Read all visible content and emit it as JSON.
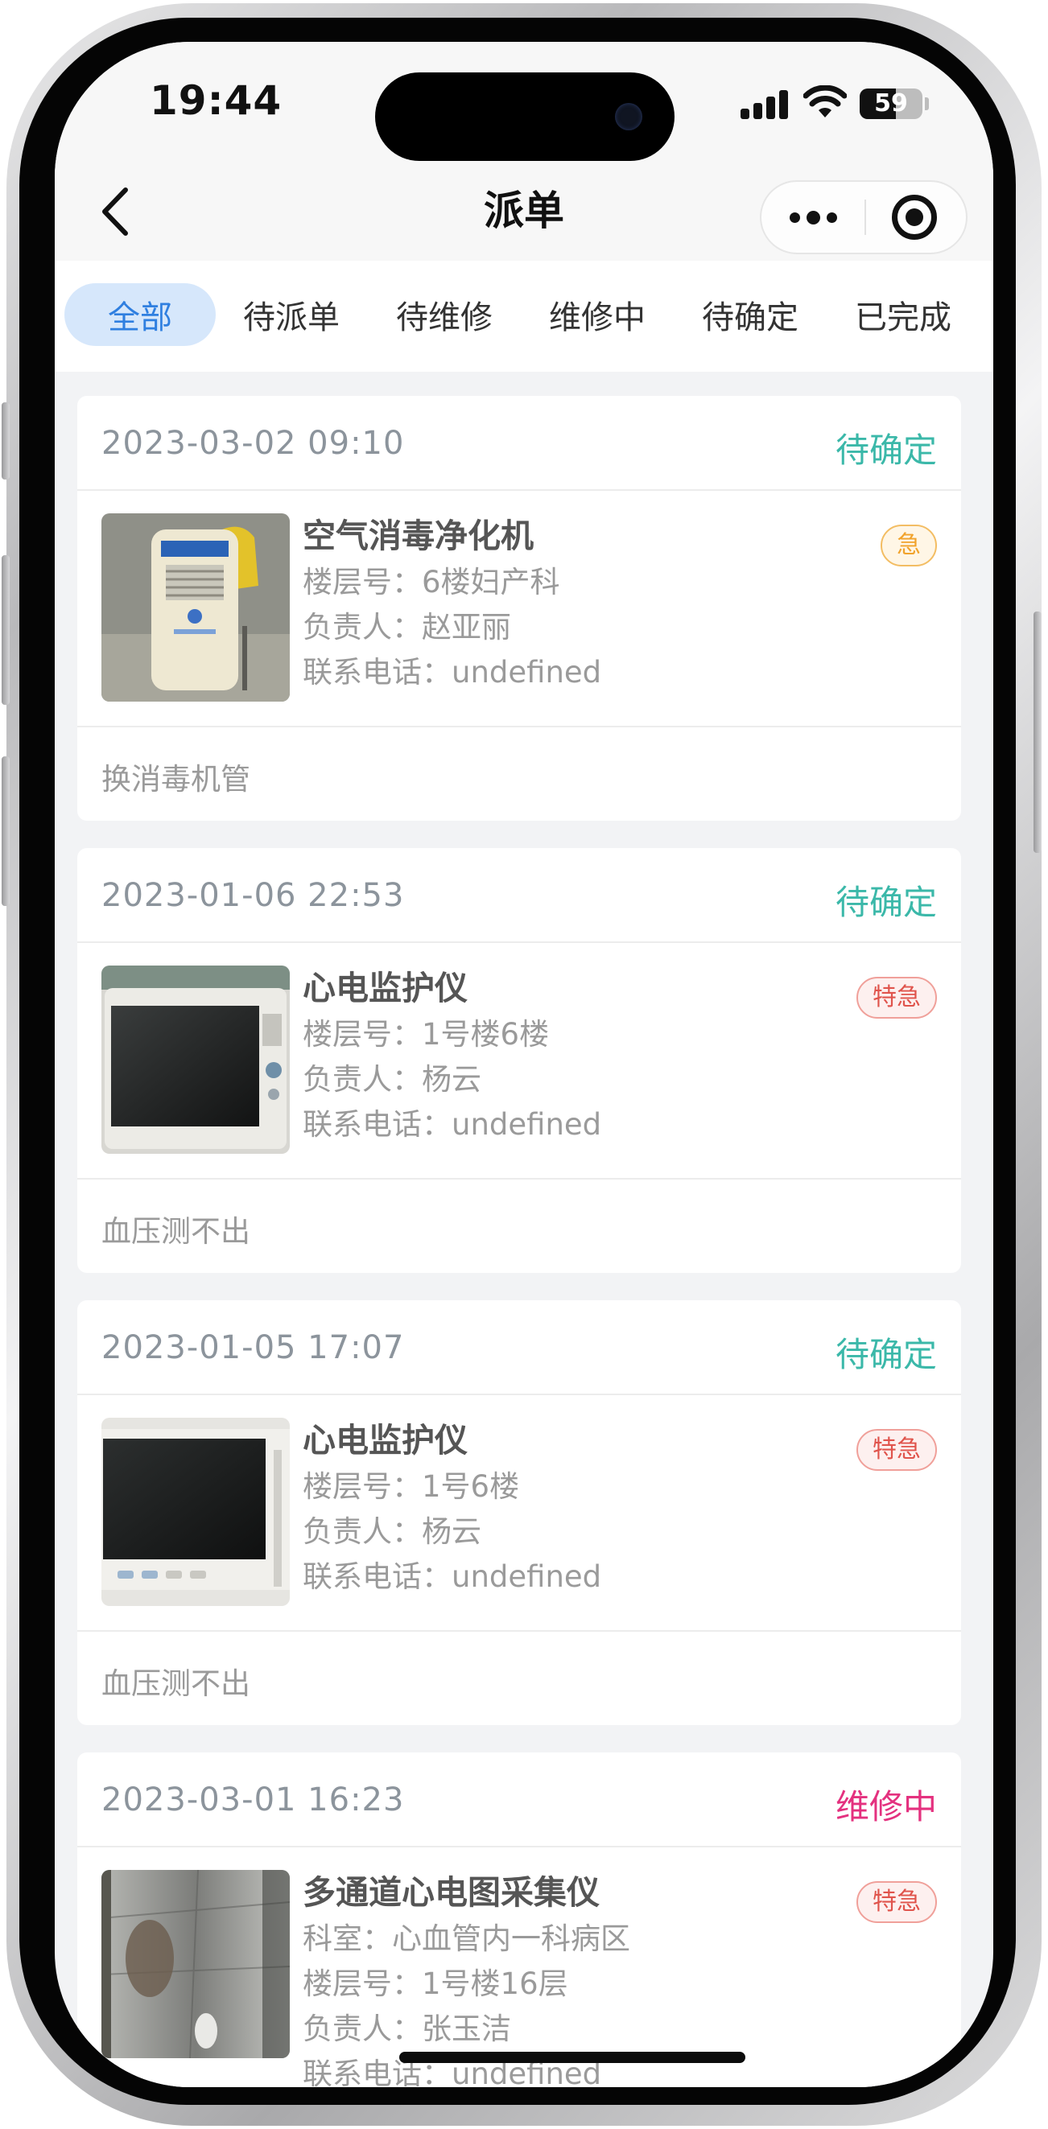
{
  "status_bar": {
    "time": "19:44",
    "battery": "59"
  },
  "nav": {
    "title": "派单"
  },
  "tabs": [
    {
      "label": "全部",
      "active": true
    },
    {
      "label": "待派单",
      "active": false
    },
    {
      "label": "待维修",
      "active": false
    },
    {
      "label": "维修中",
      "active": false
    },
    {
      "label": "待确定",
      "active": false
    },
    {
      "label": "已完成",
      "active": false
    }
  ],
  "orders": [
    {
      "date": "2023-03-02 09:10",
      "status": "待确定",
      "status_color": "#3bb8a9",
      "device": "空气消毒净化机",
      "priority": "急",
      "lines": [
        "楼层号：6楼妇产科",
        "负责人：赵亚丽",
        "联系电话：undefined"
      ],
      "remark": "换消毒机管"
    },
    {
      "date": "2023-01-06 22:53",
      "status": "待确定",
      "status_color": "#3bb8a9",
      "device": "心电监护仪",
      "priority": "特急",
      "lines": [
        "楼层号：1号楼6楼",
        "负责人：杨云",
        "联系电话：undefined"
      ],
      "remark": "血压测不出"
    },
    {
      "date": "2023-01-05 17:07",
      "status": "待确定",
      "status_color": "#3bb8a9",
      "device": "心电监护仪",
      "priority": "特急",
      "lines": [
        "楼层号：1号6楼",
        "负责人：杨云",
        "联系电话：undefined"
      ],
      "remark": "血压测不出"
    },
    {
      "date": "2023-03-01 16:23",
      "status": "维修中",
      "status_color": "#e4317f",
      "device": "多通道心电图采集仪",
      "priority": "特急",
      "lines": [
        "科室：心血管内一科病区",
        "楼层号：1号楼16层",
        "负责人：张玉洁",
        "联系电话：undefined"
      ],
      "remark": ""
    }
  ],
  "colors": {
    "accent_blue": "#2f7fe0",
    "tab_active_bg": "#d6e7fb",
    "pending_confirm": "#3bb8a9",
    "in_repair": "#e4317f",
    "urgent": "#f1a32c",
    "very_urgent": "#e0544c"
  }
}
